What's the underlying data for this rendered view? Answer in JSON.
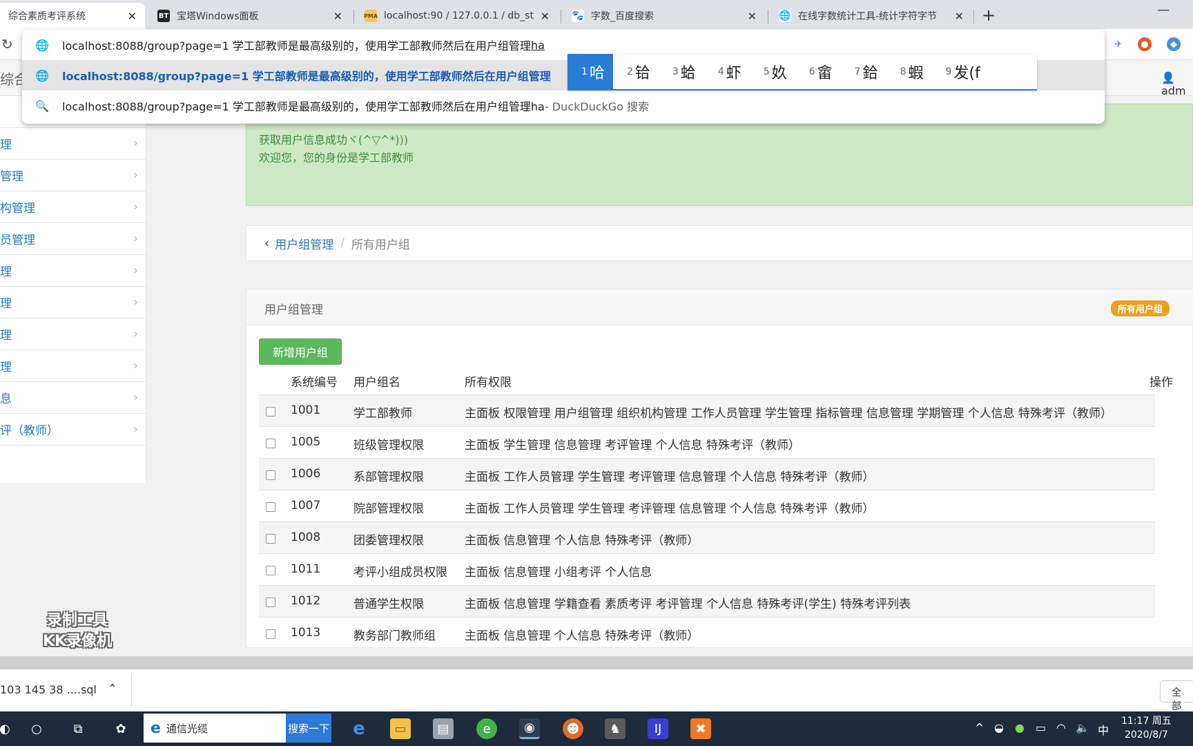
{
  "browser": {
    "tabs": [
      {
        "label": "综合素质考评系统",
        "favicon": "globe"
      },
      {
        "label": "宝塔Windows面板",
        "favicon": "BT"
      },
      {
        "label": "localhost:90 / 127.0.0.1 / db_st",
        "favicon": "PMA"
      },
      {
        "label": "字数_百度搜索",
        "favicon": "baidu-paw"
      },
      {
        "label": "在线字数统计工具-统计字符字节",
        "favicon": "globe"
      }
    ],
    "omnibox": {
      "input_text": "localhost:8088/group?page=1 学工部教师是最高级别的，使用学工部教师然后在用户组管理",
      "input_composing": "ha",
      "suggestion_1": "localhost:8088/group?page=1 学工部教师是最高级别的，使用学工部教师然后在用户组管理",
      "suggestion_2": "localhost:8088/group?page=1 学工部教师是最高级别的，使用学工部教师然后在用户组管理ha",
      "suggestion_2_suffix": " - DuckDuckGo 搜索"
    },
    "ime_candidates": [
      {
        "num": "1",
        "char": "哈"
      },
      {
        "num": "2",
        "char": "铪"
      },
      {
        "num": "3",
        "char": "蛤"
      },
      {
        "num": "4",
        "char": "虾"
      },
      {
        "num": "5",
        "char": "奺"
      },
      {
        "num": "6",
        "char": "畲"
      },
      {
        "num": "7",
        "char": "鉿"
      },
      {
        "num": "8",
        "char": "蝦"
      },
      {
        "num": "9",
        "char": "发(f"
      }
    ]
  },
  "app": {
    "title": "综合",
    "user": "adm"
  },
  "sidebar": {
    "items": [
      {
        "label": ""
      },
      {
        "label": "理"
      },
      {
        "label": "管理"
      },
      {
        "label": "构管理"
      },
      {
        "label": "员管理"
      },
      {
        "label": "理"
      },
      {
        "label": "理"
      },
      {
        "label": "理"
      },
      {
        "label": "理"
      },
      {
        "label": "息"
      },
      {
        "label": "评（教师）"
      }
    ]
  },
  "alert": {
    "line1": "获取用户信息成功ヾ(^▽^*)))",
    "line2": "欢迎您，您的身份是学工部教师"
  },
  "breadcrumb": {
    "parent": "用户组管理",
    "current": "所有用户组"
  },
  "panel": {
    "title": "用户组管理",
    "badge": "所有用户组",
    "add_button": "新增用户组",
    "columns": {
      "id": "系统编号",
      "name": "用户组名",
      "perms": "所有权限",
      "ops": "操作"
    },
    "rows": [
      {
        "id": "1001",
        "name": "学工部教师",
        "perms": "主面板 权限管理 用户组管理 组织机构管理 工作人员管理 学生管理 指标管理 信息管理 学期管理 个人信息 特殊考评（教师）"
      },
      {
        "id": "1005",
        "name": "班级管理权限",
        "perms": "主面板 学生管理 信息管理 考评管理 个人信息 特殊考评（教师）"
      },
      {
        "id": "1006",
        "name": "系部管理权限",
        "perms": "主面板 工作人员管理 学生管理 考评管理 信息管理 个人信息 特殊考评（教师）"
      },
      {
        "id": "1007",
        "name": "院部管理权限",
        "perms": "主面板 工作人员管理 学生管理 考评管理 信息管理 个人信息 特殊考评（教师）"
      },
      {
        "id": "1008",
        "name": "团委管理权限",
        "perms": "主面板 信息管理 个人信息 特殊考评（教师）"
      },
      {
        "id": "1011",
        "name": "考评小组成员权限",
        "perms": "主面板 信息管理 小组考评 个人信息"
      },
      {
        "id": "1012",
        "name": "普通学生权限",
        "perms": "主面板 信息管理 学籍查看 素质考评 考评管理 个人信息 特殊考评(学生) 特殊考评列表"
      },
      {
        "id": "1013",
        "name": "教务部门教师组",
        "perms": "主面板 信息管理 个人信息 特殊考评（教师）"
      }
    ]
  },
  "watermark": {
    "line1": "录制工具",
    "line2": "KK录像机"
  },
  "downloads": {
    "item": "103 145 38 ....sql",
    "show_all": "全部"
  },
  "taskbar": {
    "search_text": "通信光缆",
    "search_button": "搜索一下",
    "ime_indicator": "中",
    "time": "11:17 周五",
    "date": "2020/8/7"
  },
  "colors": {
    "link_blue": "#2a7ab8",
    "success_bg": "#cfe8c8",
    "success_text": "#3f8f3a",
    "button_green": "#5cb85c",
    "badge_orange": "#f0a020",
    "ime_blue": "#2a7bd6"
  }
}
